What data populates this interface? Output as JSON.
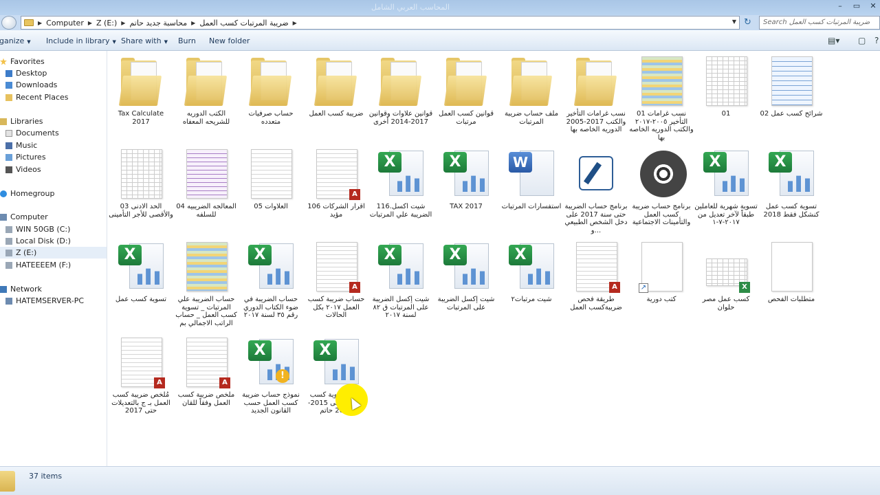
{
  "window": {
    "title": "المحاسب العربي الشامل",
    "controls": [
      "–",
      "▭",
      "✕"
    ]
  },
  "address": {
    "path": [
      "Computer",
      "Z (E:)",
      "محاسبة جديد حاتم",
      "ضريبة المرتبات كسب العمل"
    ],
    "search_placeholder": "Search ضريبة المرتبات كسب العمل"
  },
  "toolbar": {
    "items": [
      {
        "label": "Organize",
        "caret": true
      },
      {
        "label": "Include in library",
        "caret": true
      },
      {
        "label": "Share with",
        "caret": true
      },
      {
        "label": "Burn",
        "caret": false
      },
      {
        "label": "New folder",
        "caret": false
      }
    ]
  },
  "sidebar": {
    "favorites": {
      "label": "Favorites",
      "items": [
        "Desktop",
        "Downloads",
        "Recent Places"
      ]
    },
    "libraries": {
      "label": "Libraries",
      "items": [
        "Documents",
        "Music",
        "Pictures",
        "Videos"
      ]
    },
    "homegroup": {
      "label": "Homegroup"
    },
    "computer": {
      "label": "Computer",
      "items": [
        "WIN 50GB (C:)",
        "Local Disk (D:)",
        "Z (E:)",
        "HATEEEEM (F:)"
      ]
    },
    "network": {
      "label": "Network",
      "items": [
        "HATEMSERVER-PC"
      ]
    }
  },
  "files": [
    {
      "name": "Tax Calculate 2017",
      "type": "folder"
    },
    {
      "name": "الكتب الدوريه للشريحه المعفاه",
      "type": "folder"
    },
    {
      "name": "حساب صرفيات متعدده",
      "type": "folder"
    },
    {
      "name": "ضريبة كسب العمل",
      "type": "folder"
    },
    {
      "name": "قوانين علاوات وقوانين 2017-2014 أخرى",
      "type": "folder"
    },
    {
      "name": "قوانين كسب العمل مرتبات",
      "type": "folder"
    },
    {
      "name": "ملف حساب ضريبة المرتبات",
      "type": "folder"
    },
    {
      "name": "نسب غرامات التأخير والكتب 2017-2005 الدوريه الخاصه بها",
      "type": "folder"
    },
    {
      "name": "01 نسب غرامات التأخير ٢٠٠٥-٢٠١٧ والكتب الدوريه الخاصه بها",
      "type": "image"
    },
    {
      "name": "01",
      "type": "image"
    },
    {
      "name": "02 شرائح كسب عمل",
      "type": "image"
    },
    {
      "name": "03 الحد الادنى والأقصى للأجر التأمينى",
      "type": "image"
    },
    {
      "name": "04 المعالجه الضريبيه للسلفه",
      "type": "image"
    },
    {
      "name": "05 العلاوات",
      "type": "image"
    },
    {
      "name": "106 اقرار الشركات مؤيد",
      "type": "pdf"
    },
    {
      "name": "116.شيت اكسل الضريبة علي المرتبات",
      "type": "excel"
    },
    {
      "name": "TAX 2017",
      "type": "excel"
    },
    {
      "name": "استفسارات المرتبات",
      "type": "word"
    },
    {
      "name": "برنامج حساب الضريبة حتى سنة 2017 على دخل الشخص الطبيعي و...",
      "type": "app"
    },
    {
      "name": "برنامج حساب ضريبة كسب العمل والتأمينات الاجتماعية",
      "type": "disc"
    },
    {
      "name": "تسوية شهرية للعاملين طبقاً لآخر تعديل من ٢٠١٧-٧-١",
      "type": "excel"
    },
    {
      "name": "تسوية كسب عمل كنشكل فقط 2018",
      "type": "excel"
    },
    {
      "name": "تسوية كسب عمل",
      "type": "excel"
    },
    {
      "name": "حساب الضريبة علي المرتبات _ تسوية كسب العمل _ حساب الراتب الاجمالي بم",
      "type": "video"
    },
    {
      "name": "حساب الضريبة في ضوء الكتاب الدوري رقم ٣٥ لسنة ٢٠١٧",
      "type": "excel"
    },
    {
      "name": "حساب ضريبة كسب العمل ٢٠١٧ بكل الحالات",
      "type": "pdf"
    },
    {
      "name": "شيت إكسل الضريبة على المرتبات ق ٨٢ لسنة ٢٠١٧",
      "type": "excel"
    },
    {
      "name": "شيت إكسل الضريبة على المرتبات",
      "type": "excel"
    },
    {
      "name": "شيت مرتبات٢",
      "type": "excel"
    },
    {
      "name": "طريقة فحص ضريبةكسب العمل",
      "type": "pdf"
    },
    {
      "name": "كتب دورية",
      "type": "shortcut"
    },
    {
      "name": "كسب عمل مصر حلوان",
      "type": "xls-image"
    },
    {
      "name": "متطلبات الفحص",
      "type": "blank"
    },
    {
      "name": "مُلخص ضريبة كسب العمل بـ ج بالتعديلات حتى 2017",
      "type": "pdf"
    },
    {
      "name": "ملخص ضريبة كسب العمل وفقاً للقان",
      "type": "pdf"
    },
    {
      "name": "نموذج حساب ضريبة كسب العمل حسب القانون الجديد",
      "type": "excel-warn"
    },
    {
      "name": "نهائى تسوية كسب العمل عامى 2015- 2012 حاتم",
      "type": "excel"
    }
  ],
  "status": {
    "count_text": "37 items"
  }
}
